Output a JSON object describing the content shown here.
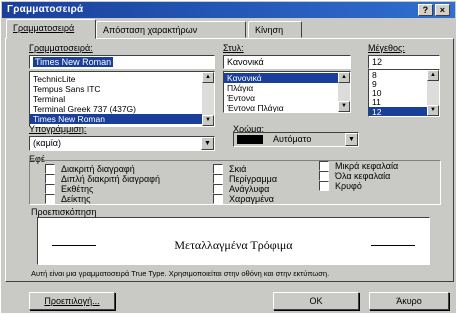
{
  "window": {
    "title": "Γραμματοσειρά",
    "help_label": "?",
    "close_label": "×"
  },
  "tabs": [
    {
      "label": "Γραμματοσειρά",
      "active": true
    },
    {
      "label": "Απόσταση χαρακτήρων",
      "active": false
    },
    {
      "label": "Κίνηση",
      "active": false
    }
  ],
  "font": {
    "label": "Γραμματοσειρά:",
    "value": "Times New Roman",
    "items": [
      "TechnicLite",
      "Tempus Sans ITC",
      "Terminal",
      "Terminal Greek 737 (437G)",
      "Times New Roman"
    ],
    "selected_index": 4
  },
  "style": {
    "label": "Στυλ:",
    "value": "Κανονικά",
    "items": [
      "Κανονικά",
      "Πλάγια",
      "Έντονα",
      "Έντονα Πλάγια"
    ],
    "selected_index": 0
  },
  "size": {
    "label": "Μέγεθος:",
    "value": "12",
    "items": [
      "8",
      "9",
      "10",
      "11",
      "12"
    ],
    "selected_index": 4
  },
  "underline": {
    "label": "Υπογράμμιση:",
    "value": "(καμία)"
  },
  "color": {
    "label": "Χρώμα:",
    "value": "Αυτόματο",
    "swatch": "#000000"
  },
  "effects": {
    "label": "Εφέ",
    "col1": [
      "Διακριτή διαγραφή",
      "Διπλή διακριτή διαγραφή",
      "Εκθέτης",
      "Δείκτης"
    ],
    "col2": [
      "Σκιά",
      "Περίγραμμα",
      "Ανάγλυφα",
      "Χαραγμένα"
    ],
    "col3": [
      "Μικρά κεφαλαία",
      "Όλα κεφαλαία",
      "Κρυφό"
    ]
  },
  "preview": {
    "label": "Προεπισκόπηση",
    "sample": "Μεταλλαγμένα Τρόφιμα",
    "note": "Αυτή είναι μια γραμματοσειρά True Type. Χρησιμοποιείται στην οθόνη και στην εκτύπωση."
  },
  "buttons": {
    "default": "Προεπιλογή...",
    "ok": "OK",
    "cancel": "Άκυρο"
  },
  "colors": {
    "titlebar": "#1a3f9a",
    "face": "#c9c9c6",
    "selection": "#1a3f9a"
  }
}
